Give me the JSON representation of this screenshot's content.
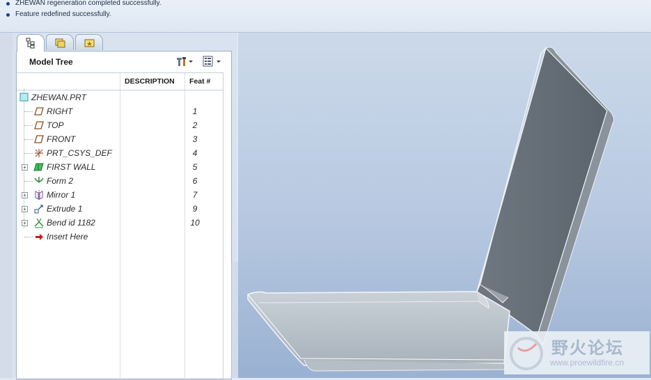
{
  "messages": [
    "ZHEWAN regeneration completed successfully.",
    "Feature redefined successfully."
  ],
  "panel": {
    "tabs": [
      {
        "icon": "model-tree-tab-icon"
      },
      {
        "icon": "folder-browser-tab-icon"
      },
      {
        "icon": "favorites-tab-icon"
      }
    ],
    "title": "Model Tree",
    "settings_icon": "tools-icon",
    "show_icon": "list-settings-icon",
    "columns": {
      "description": "DESCRIPTION",
      "feat": "Feat #"
    },
    "root": {
      "name": "ZHEWAN.PRT",
      "icon": "part-icon"
    },
    "items": [
      {
        "name": "RIGHT",
        "feat": "1",
        "icon": "datum-plane-icon",
        "expandable": false
      },
      {
        "name": "TOP",
        "feat": "2",
        "icon": "datum-plane-icon",
        "expandable": false
      },
      {
        "name": "FRONT",
        "feat": "3",
        "icon": "datum-plane-icon",
        "expandable": false
      },
      {
        "name": "PRT_CSYS_DEF",
        "feat": "4",
        "icon": "coordinate-system-icon",
        "expandable": false
      },
      {
        "name": "FIRST WALL",
        "feat": "5",
        "icon": "sheetmetal-wall-icon",
        "expandable": true
      },
      {
        "name": "Form 2",
        "feat": "6",
        "icon": "form-icon",
        "expandable": false
      },
      {
        "name": "Mirror 1",
        "feat": "7",
        "icon": "mirror-icon",
        "expandable": true
      },
      {
        "name": "Extrude 1",
        "feat": "9",
        "icon": "extrude-icon",
        "expandable": true
      },
      {
        "name": "Bend id 1182",
        "feat": "10",
        "icon": "bend-icon",
        "expandable": true
      },
      {
        "name": "Insert Here",
        "feat": "",
        "icon": "insert-arrow-icon",
        "expandable": false
      }
    ]
  },
  "watermark": {
    "text": "野火论坛",
    "url": "www.proewildfire.cn"
  }
}
